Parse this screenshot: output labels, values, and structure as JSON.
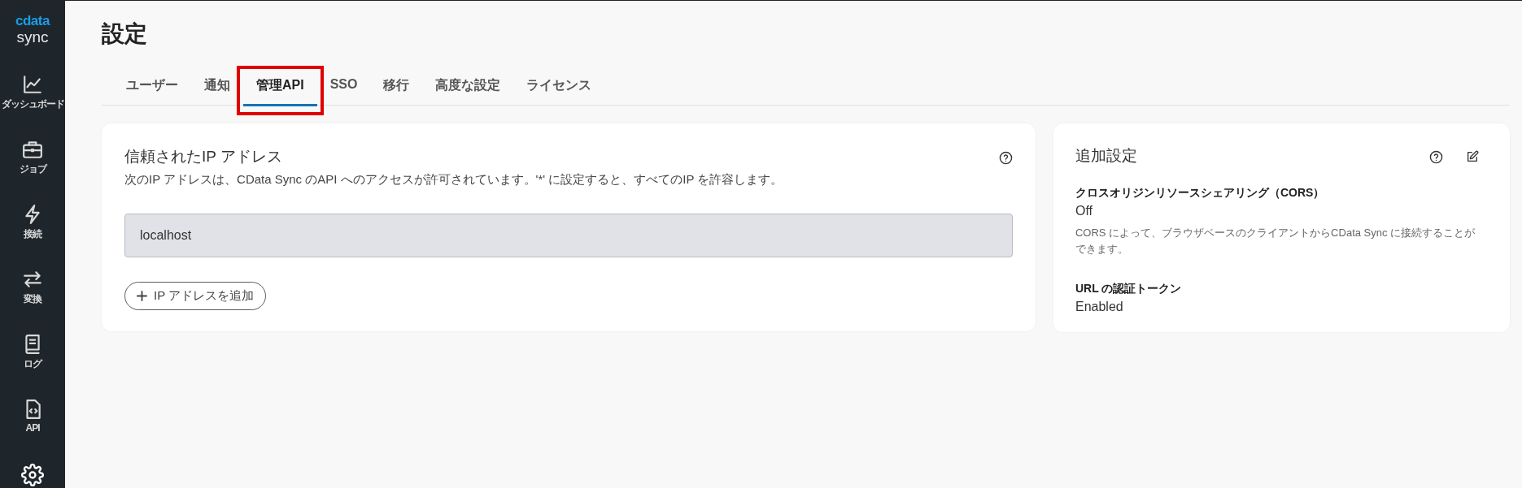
{
  "logo": {
    "brand": "cdata",
    "product": "sync"
  },
  "sidebar": {
    "items": [
      {
        "kind": "chart",
        "label": "ダッシュボード",
        "selected": false
      },
      {
        "kind": "briefcase",
        "label": "ジョブ",
        "selected": false
      },
      {
        "kind": "bolt",
        "label": "接続",
        "selected": false
      },
      {
        "kind": "swap",
        "label": "変換",
        "selected": false
      },
      {
        "kind": "book",
        "label": "ログ",
        "selected": false
      },
      {
        "kind": "file-code",
        "label": "API",
        "selected": false
      },
      {
        "kind": "gear",
        "selected": true
      }
    ]
  },
  "page_title": "設定",
  "tabs": [
    {
      "label": "ユーザー",
      "selected": false,
      "highlighted": false
    },
    {
      "label": "通知",
      "selected": false,
      "highlighted": false
    },
    {
      "label": "管理API",
      "selected": true,
      "highlighted": true
    },
    {
      "label": "SSO",
      "selected": false,
      "highlighted": false
    },
    {
      "label": "移行",
      "selected": false,
      "highlighted": false
    },
    {
      "label": "高度な設定",
      "selected": false,
      "highlighted": false
    },
    {
      "label": "ライセンス",
      "selected": false,
      "highlighted": false
    }
  ],
  "trusted_ip_card": {
    "title": "信頼されたIP アドレス",
    "description": "次のIP アドレスは、CData Sync のAPI へのアクセスが許可されています。'*' に設定すると、すべてのIP を許容します。",
    "ip_fields": [
      {
        "value": "localhost",
        "disabled": true
      }
    ],
    "add_button": "IP アドレスを追加"
  },
  "additional_card": {
    "title": "追加設定",
    "settings": [
      {
        "label": "クロスオリジンリソースシェアリング（CORS）",
        "value": "Off",
        "description": "CORS によって、ブラウザベースのクライアントからCData Sync に接続することができます。"
      },
      {
        "label": "URL の認証トークン",
        "value": "Enabled"
      }
    ]
  }
}
